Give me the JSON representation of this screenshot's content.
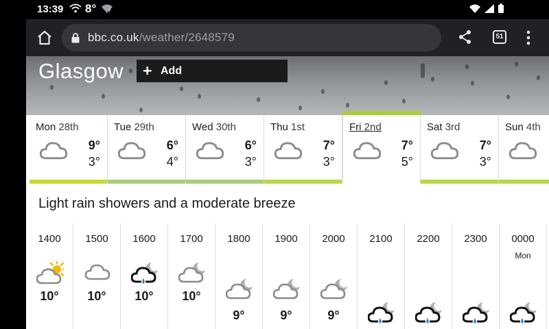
{
  "status_bar": {
    "time": "13:39",
    "temperature": "8°"
  },
  "browser": {
    "url_domain": "bbc.co.uk",
    "url_path": "/weather/2648579",
    "tab_count": "51"
  },
  "location": {
    "name": "Glasgow",
    "add_label": "Add"
  },
  "days": [
    {
      "day": "Mon",
      "date": "28th",
      "high": "9°",
      "low": "3°",
      "icon": "cloud-icon",
      "bar_color": "#c8d932"
    },
    {
      "day": "Tue",
      "date": "29th",
      "high": "6°",
      "low": "4°",
      "icon": "cloud-icon",
      "bar_color": "#a6cf7a"
    },
    {
      "day": "Wed",
      "date": "30th",
      "high": "6°",
      "low": "3°",
      "icon": "cloud-icon",
      "bar_color": "#a6cf7a"
    },
    {
      "day": "Thu",
      "date": "1st",
      "high": "7°",
      "low": "3°",
      "icon": "cloud-icon",
      "bar_color": "#b7d84a"
    },
    {
      "day": "Fri",
      "date": "2nd",
      "high": "7°",
      "low": "5°",
      "icon": "cloud-icon",
      "bar_color": "#a6cf37"
    },
    {
      "day": "Sat",
      "date": "3rd",
      "high": "7°",
      "low": "3°",
      "icon": "cloud-icon",
      "bar_color": "#b7d84a"
    },
    {
      "day": "Sun",
      "date": "4th",
      "high": "",
      "low": "",
      "icon": "cloud-icon",
      "bar_color": "#b7d84a"
    }
  ],
  "selected_day_index": 4,
  "summary": "Light rain showers and a moderate breeze",
  "hourly": [
    {
      "time": "1400",
      "sub": "",
      "temp": "10°",
      "icon": "sun-cloud-icon"
    },
    {
      "time": "1500",
      "sub": "",
      "temp": "10°",
      "icon": "cloud-icon"
    },
    {
      "time": "1600",
      "sub": "",
      "temp": "10°",
      "icon": "rain-shower-night-icon"
    },
    {
      "time": "1700",
      "sub": "",
      "temp": "10°",
      "icon": "cloud-night-icon"
    },
    {
      "time": "1800",
      "sub": "",
      "temp": "9°",
      "icon": "cloud-night-icon"
    },
    {
      "time": "1900",
      "sub": "",
      "temp": "9°",
      "icon": "cloud-night-icon"
    },
    {
      "time": "2000",
      "sub": "",
      "temp": "9°",
      "icon": "cloud-night-icon"
    },
    {
      "time": "2100",
      "sub": "",
      "temp": "",
      "icon": "rain-shower-night-icon"
    },
    {
      "time": "2200",
      "sub": "",
      "temp": "",
      "icon": "rain-shower-night-icon"
    },
    {
      "time": "2300",
      "sub": "",
      "temp": "",
      "icon": "rain-shower-night-icon"
    },
    {
      "time": "0000",
      "sub": "Mon",
      "temp": "",
      "icon": "rain-shower-night-icon"
    }
  ]
}
